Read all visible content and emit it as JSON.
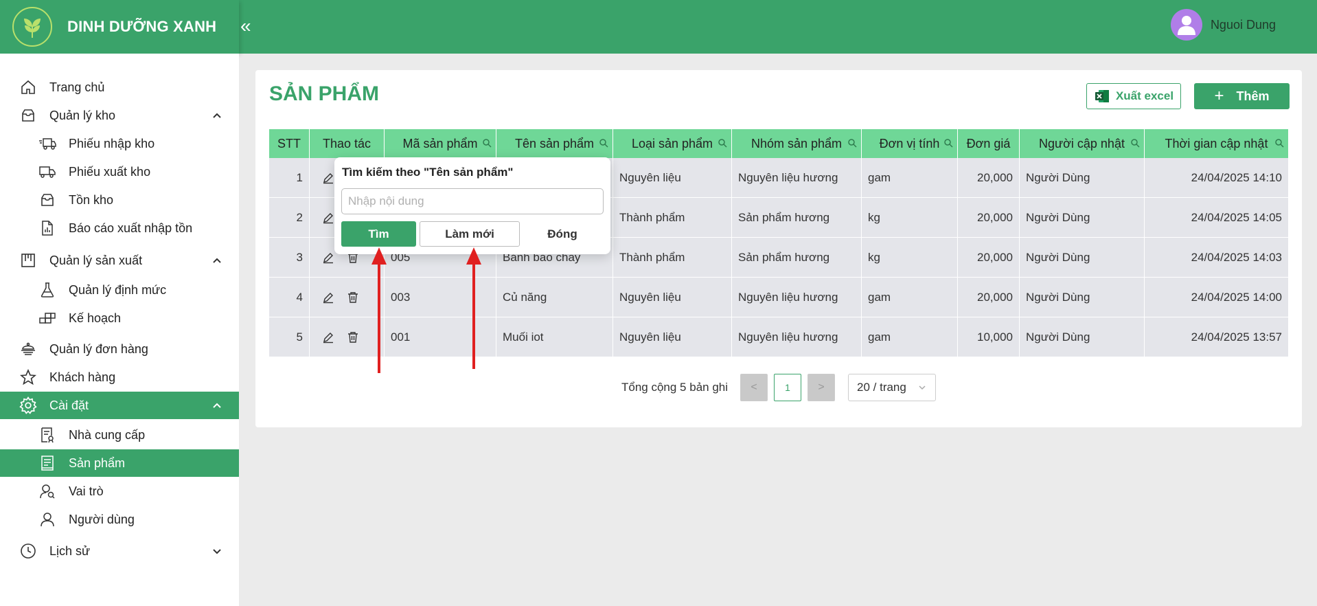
{
  "header": {
    "brand": "DINH DƯỠNG XANH",
    "collapse_glyph": "«",
    "user_name": "Nguoi Dung"
  },
  "sidebar": {
    "items": [
      {
        "label": "Trang chủ",
        "icon": "home-icon"
      },
      {
        "label": "Quản lý kho",
        "icon": "inbox-icon",
        "expanded": true
      },
      {
        "label": "Phiếu nhập kho",
        "icon": "truck-in-icon"
      },
      {
        "label": "Phiếu xuất kho",
        "icon": "truck-out-icon"
      },
      {
        "label": "Tồn kho",
        "icon": "box-icon"
      },
      {
        "label": "Báo cáo xuất nhập tồn",
        "icon": "report-icon"
      },
      {
        "label": "Quản lý sản xuất",
        "icon": "factory-icon",
        "expanded": true
      },
      {
        "label": "Quản lý định mức",
        "icon": "flask-icon"
      },
      {
        "label": "Kế hoạch",
        "icon": "blocks-icon"
      },
      {
        "label": "Quản lý đơn hàng",
        "icon": "orders-icon"
      },
      {
        "label": "Khách hàng",
        "icon": "star-icon"
      },
      {
        "label": "Cài đặt",
        "icon": "gear-icon",
        "expanded": true
      },
      {
        "label": "Nhà cung cấp",
        "icon": "supplier-icon"
      },
      {
        "label": "Sản phẩm",
        "icon": "product-icon"
      },
      {
        "label": "Vai trò",
        "icon": "role-icon"
      },
      {
        "label": "Người dùng",
        "icon": "user-icon"
      },
      {
        "label": "Lịch sử",
        "icon": "history-icon",
        "expanded": false
      }
    ]
  },
  "page": {
    "title": "SẢN PHẨM",
    "export_label": "Xuất excel",
    "add_label": "Thêm"
  },
  "table": {
    "columns": [
      "STT",
      "Thao tác",
      "Mã sản phẩm",
      "Tên sản phẩm",
      "Loại sản phẩm",
      "Nhóm sản phẩm",
      "Đơn vị tính",
      "Đơn giá",
      "Người cập nhật",
      "Thời gian cập nhật"
    ],
    "rows": [
      {
        "stt": "1",
        "code": "",
        "name": "",
        "type": "Nguyên liệu",
        "group": "Nguyên liệu hương",
        "unit": "gam",
        "price": "20,000",
        "user": "Người Dùng",
        "time": "24/04/2025 14:10"
      },
      {
        "stt": "2",
        "code": "",
        "name": "",
        "type": "Thành phẩm",
        "group": "Sản phẩm hương",
        "unit": "kg",
        "price": "20,000",
        "user": "Người Dùng",
        "time": "24/04/2025 14:05"
      },
      {
        "stt": "3",
        "code": "005",
        "name": "Bánh bao chay",
        "type": "Thành phẩm",
        "group": "Sản phẩm hương",
        "unit": "kg",
        "price": "20,000",
        "user": "Người Dùng",
        "time": "24/04/2025 14:03"
      },
      {
        "stt": "4",
        "code": "003",
        "name": "Củ năng",
        "type": "Nguyên liệu",
        "group": "Nguyên liệu hương",
        "unit": "gam",
        "price": "20,000",
        "user": "Người Dùng",
        "time": "24/04/2025 14:00"
      },
      {
        "stt": "5",
        "code": "001",
        "name": "Muối iot",
        "type": "Nguyên liệu",
        "group": "Nguyên liệu hương",
        "unit": "gam",
        "price": "10,000",
        "user": "Người Dùng",
        "time": "24/04/2025 13:57"
      }
    ]
  },
  "pagination": {
    "total_text": "Tổng cộng 5 bản ghi",
    "prev": "<",
    "current_page": "1",
    "next": ">",
    "page_size": "20 / trang"
  },
  "search_popup": {
    "title": "Tìm kiếm theo \"Tên sản phẩm\"",
    "placeholder": "Nhập nội dung",
    "search_label": "Tìm",
    "reset_label": "Làm mới",
    "close_label": "Đóng"
  },
  "colors": {
    "brand_green": "#3aa36a",
    "table_header": "#6fd797",
    "row_bg": "#e4e5ea",
    "annotation_arrow": "#e02020"
  }
}
